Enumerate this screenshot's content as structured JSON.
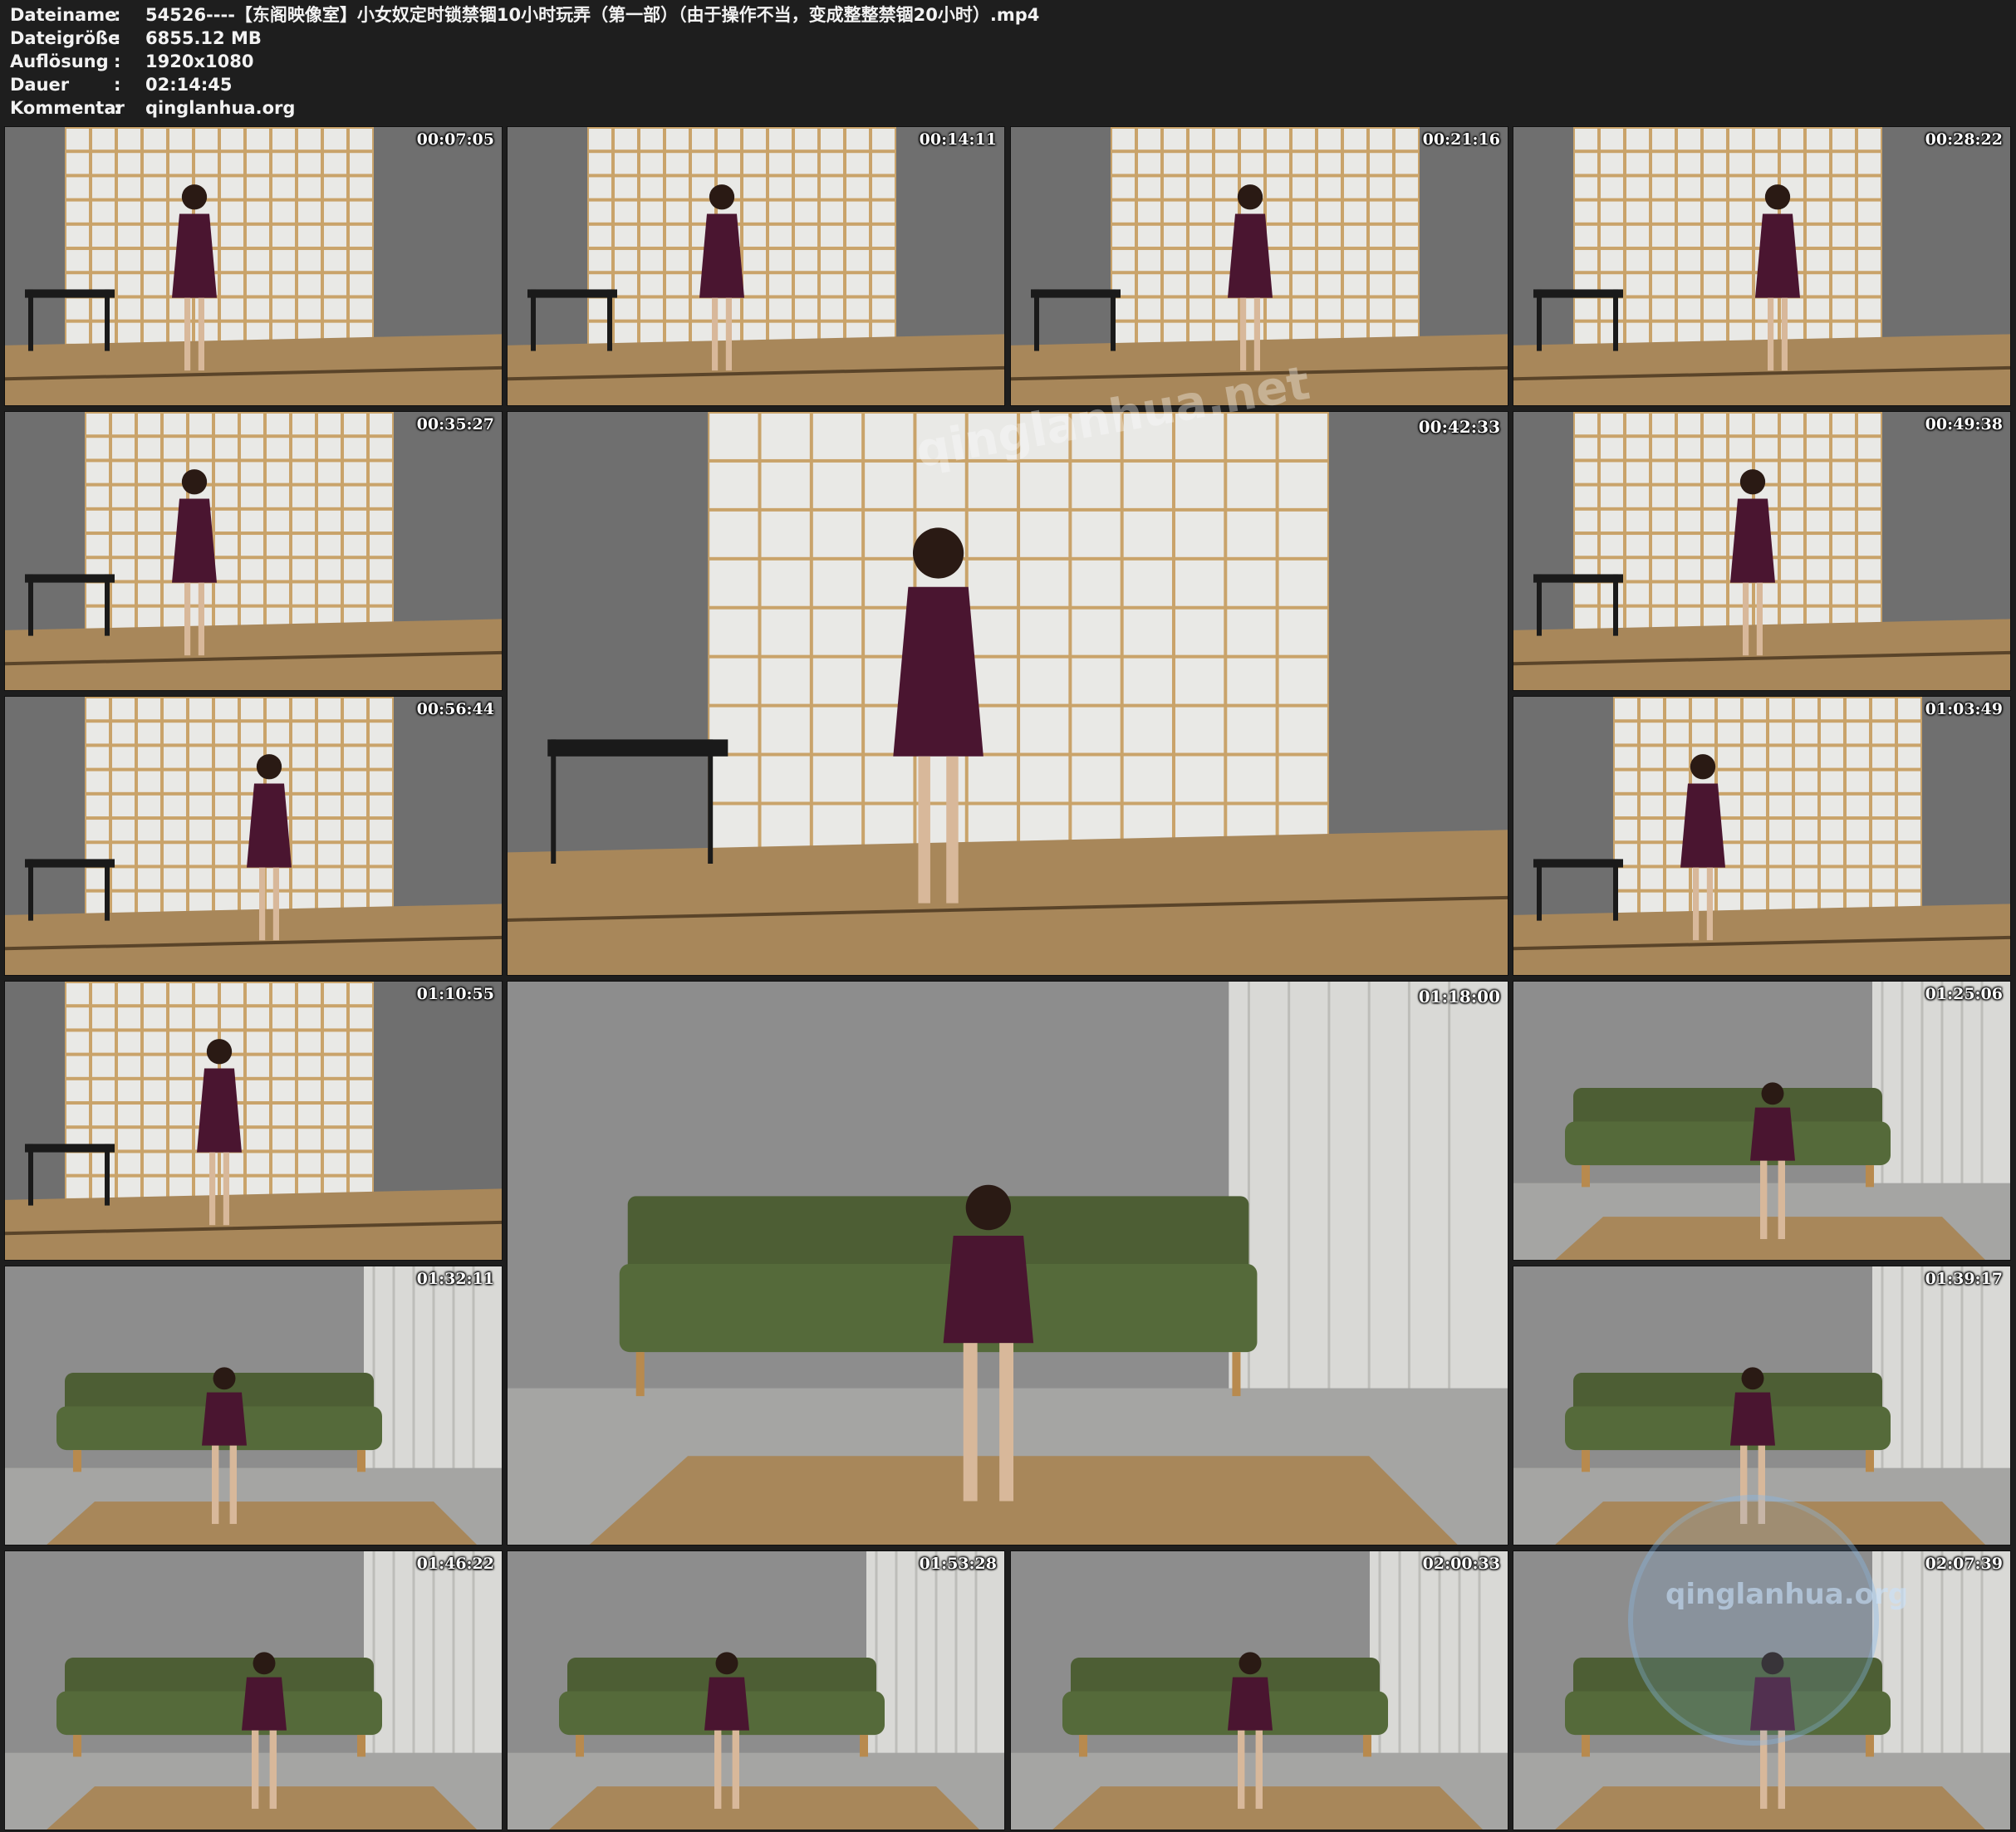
{
  "info": {
    "rows": [
      {
        "key": "Dateiname",
        "sep": ":",
        "value": "54526----【东阁映像室】小女奴定时锁禁锢10小时玩弄（第一部）（由于操作不当，变成整整禁锢20小时）.mp4"
      },
      {
        "key": "Dateigröße",
        "sep": ":",
        "value": "6855.12 MB"
      },
      {
        "key": "Auflösung",
        "sep": ":",
        "value": "1920x1080"
      },
      {
        "key": "Dauer",
        "sep": ":",
        "value": "02:14:45"
      },
      {
        "key": "Kommentar",
        "sep": ":",
        "value": "qinglanhua.org"
      }
    ]
  },
  "thumbnails": [
    {
      "timestamp": "00:07:05",
      "scene": "room"
    },
    {
      "timestamp": "00:14:11",
      "scene": "room"
    },
    {
      "timestamp": "00:21:16",
      "scene": "room"
    },
    {
      "timestamp": "00:28:22",
      "scene": "room"
    },
    {
      "timestamp": "00:35:27",
      "scene": "room"
    },
    {
      "timestamp": "00:42:33",
      "scene": "room"
    },
    {
      "timestamp": "00:49:38",
      "scene": "room"
    },
    {
      "timestamp": "00:56:44",
      "scene": "room"
    },
    {
      "timestamp": "01:03:49",
      "scene": "room"
    },
    {
      "timestamp": "01:10:55",
      "scene": "room"
    },
    {
      "timestamp": "01:18:00",
      "scene": "sofa"
    },
    {
      "timestamp": "01:25:06",
      "scene": "sofa"
    },
    {
      "timestamp": "01:32:11",
      "scene": "sofa"
    },
    {
      "timestamp": "01:39:17",
      "scene": "sofa"
    },
    {
      "timestamp": "01:46:22",
      "scene": "sofa"
    },
    {
      "timestamp": "01:53:28",
      "scene": "sofa"
    },
    {
      "timestamp": "02:00:33",
      "scene": "sofa"
    },
    {
      "timestamp": "02:07:39",
      "scene": "sofa"
    }
  ],
  "watermarks": {
    "center": "qinglanhua.net",
    "corner": "qinglanhua.org"
  },
  "colors": {
    "background": "#1e1e1e",
    "text": "#f2f2f2",
    "wall": "#6f6f6f",
    "shoji_frame": "#c9a36a",
    "shoji_paper": "#e9e9e6",
    "tatami": "#a8875a",
    "sofa": "#4d5e34",
    "dress": "#4a1530"
  }
}
